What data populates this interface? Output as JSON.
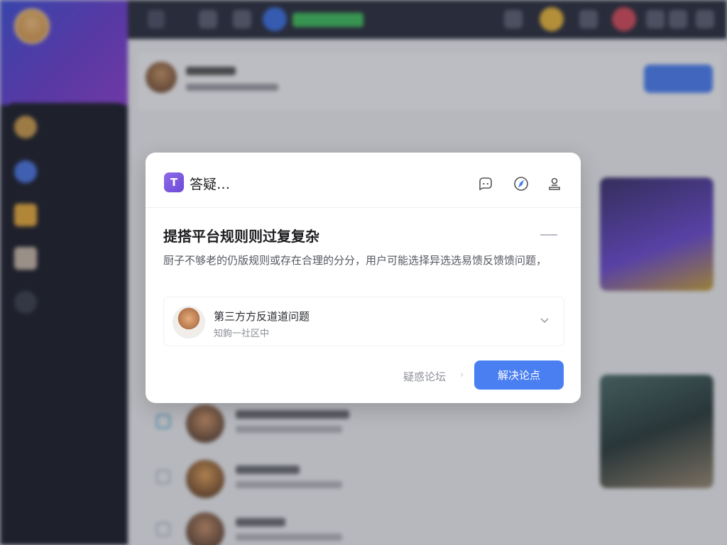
{
  "sidebar": {
    "profile_name": "",
    "search_label": "",
    "items": [
      {
        "label": ""
      },
      {
        "label": ""
      },
      {
        "label": ""
      },
      {
        "label": ""
      },
      {
        "label": ""
      }
    ]
  },
  "colors": {
    "accent": "#4a7ff2",
    "logo_purple": "#7c58e0",
    "sidebar_dark": "#1f2230"
  },
  "dialog": {
    "title": "答疑…",
    "logo_glyph": "T",
    "question": "提搭平台规则则过复复杂",
    "description": "厨子不够老的仍版规则或存在合理的分分，用户可能选择异选选易馈反馈馈问题，",
    "answer": {
      "title": "第三方方反道道问题",
      "subtitle": "知鉤一社区中"
    },
    "link_label": "疑惑论坛",
    "primary_label": "解决论点",
    "icons": [
      "chat-bubble-icon",
      "compass-icon",
      "user-stamp-icon"
    ]
  }
}
